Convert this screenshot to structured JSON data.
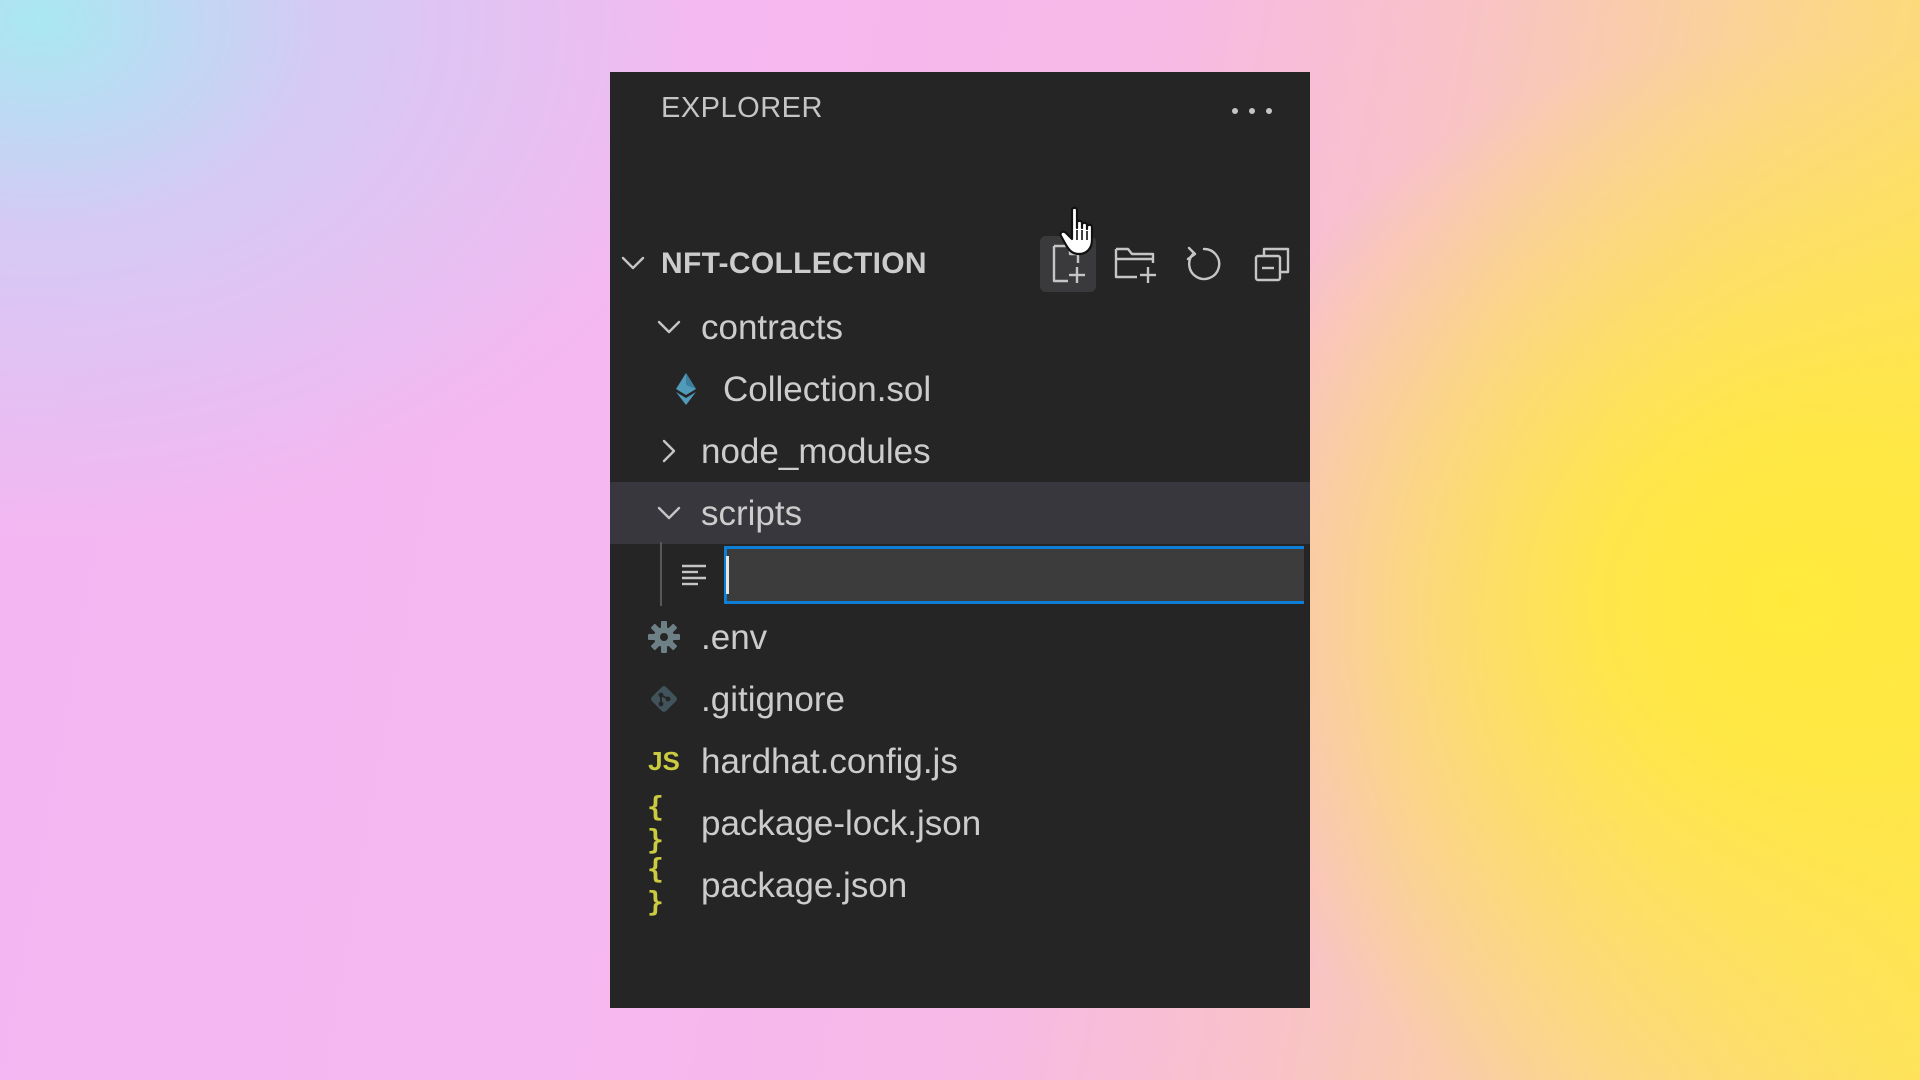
{
  "explorer": {
    "title": "EXPLORER",
    "more_actions_icon": "ellipsis-icon"
  },
  "workspace": {
    "name": "NFT-COLLECTION",
    "expanded": true,
    "actions": [
      {
        "name": "new-file",
        "icon": "new-file-icon",
        "hovered": true
      },
      {
        "name": "new-folder",
        "icon": "new-folder-icon"
      },
      {
        "name": "refresh",
        "icon": "refresh-icon"
      },
      {
        "name": "collapse-all",
        "icon": "collapse-all-icon"
      }
    ]
  },
  "tree": {
    "contracts": {
      "label": "contracts",
      "expanded": true
    },
    "collection_sol": {
      "label": "Collection.sol",
      "icon": "ethereum-icon"
    },
    "node_modules": {
      "label": "node_modules",
      "expanded": false
    },
    "scripts": {
      "label": "scripts",
      "expanded": true,
      "selected": true
    },
    "new_file_input": {
      "value": "",
      "icon": "text-file-icon"
    },
    "env": {
      "label": ".env",
      "icon": "gear-icon"
    },
    "gitignore": {
      "label": ".gitignore",
      "icon": "git-icon"
    },
    "hardhat_config": {
      "label": "hardhat.config.js",
      "icon_text": "JS"
    },
    "package_lock": {
      "label": "package-lock.json",
      "icon_text": "{ }"
    },
    "package_json": {
      "label": "package.json",
      "icon_text": "{ }"
    }
  },
  "colors": {
    "panel_bg": "#252526",
    "selected_row": "#37373d",
    "focus_border": "#0e7fd6",
    "json_js_icon": "#cbcb41",
    "solidity_icon": "#519aba"
  }
}
